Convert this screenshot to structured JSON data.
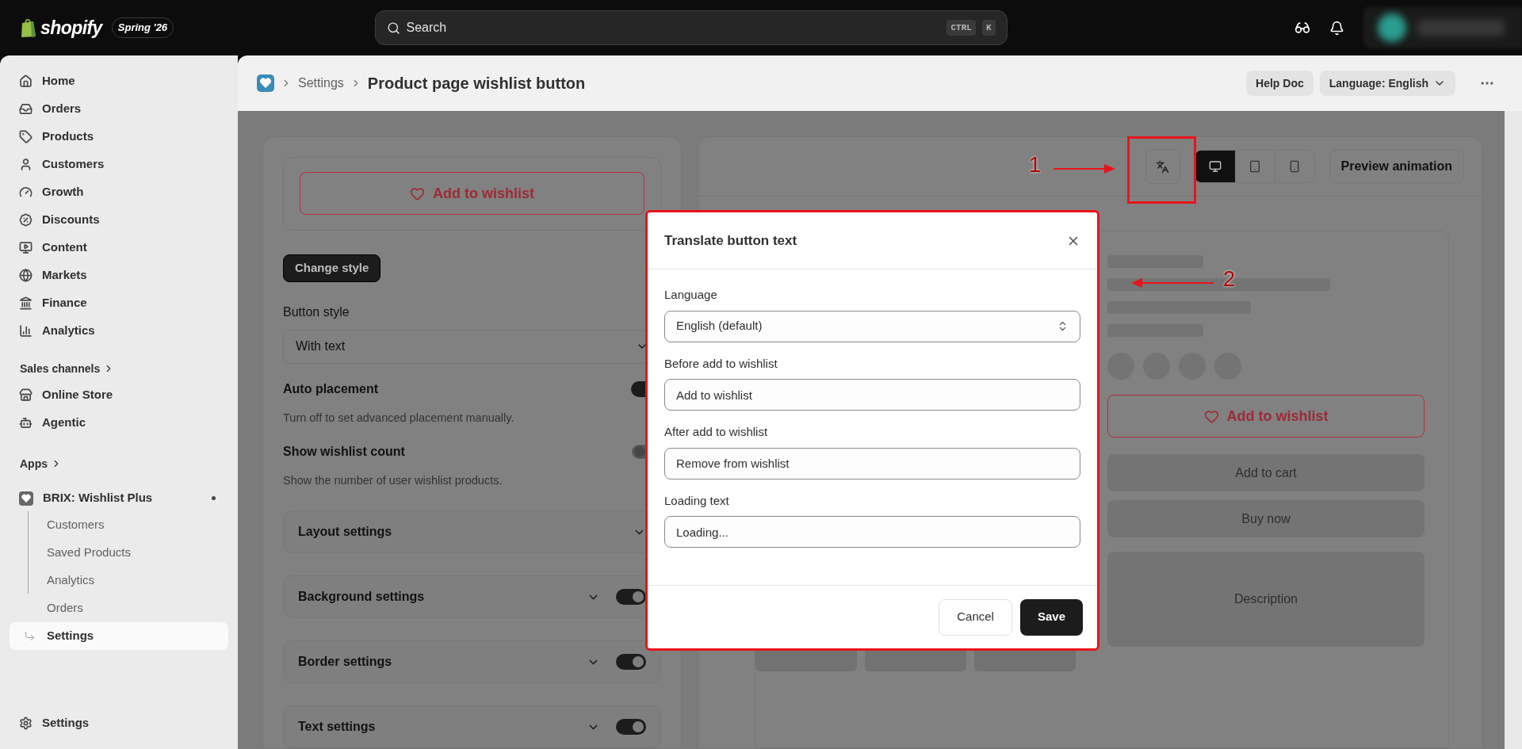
{
  "topbar": {
    "brand": "shopify",
    "badge": "Spring '26",
    "search": {
      "placeholder": "Search",
      "shortcut": [
        "CTRL",
        "K"
      ]
    }
  },
  "sidebar": {
    "items": [
      {
        "label": "Home",
        "selected": false
      },
      {
        "label": "Orders",
        "selected": false
      },
      {
        "label": "Products",
        "selected": false
      },
      {
        "label": "Customers",
        "selected": false
      },
      {
        "label": "Growth",
        "selected": false
      },
      {
        "label": "Discounts",
        "selected": false
      },
      {
        "label": "Content",
        "selected": false
      },
      {
        "label": "Markets",
        "selected": false
      },
      {
        "label": "Finance",
        "selected": false
      },
      {
        "label": "Analytics",
        "selected": false
      }
    ],
    "sales_channels": {
      "heading": "Sales channels",
      "items": [
        {
          "label": "Online Store",
          "selected": false
        },
        {
          "label": "Agentic",
          "selected": false
        }
      ]
    },
    "apps": {
      "heading": "Apps",
      "app": {
        "name": "BRIX: Wishlist Plus",
        "pinned": true,
        "children": [
          {
            "label": "Customers",
            "selected": false
          },
          {
            "label": "Saved Products",
            "selected": false
          },
          {
            "label": "Analytics",
            "selected": false
          },
          {
            "label": "Orders",
            "selected": false
          },
          {
            "label": "Settings",
            "selected": true
          }
        ]
      }
    },
    "footer_item": "Settings"
  },
  "header": {
    "breadcrumb": "Settings",
    "title": "Product page wishlist button",
    "buttons": [
      {
        "label": "Help Doc",
        "kind": "plain"
      },
      {
        "label": "Language: English",
        "kind": "dropdown"
      }
    ]
  },
  "left_panel": {
    "preview_button": "Add to wishlist",
    "change_style": "Change style",
    "button_style": {
      "label": "Button style",
      "value": "With text"
    },
    "toggles": [
      {
        "label": "Auto placement",
        "description": "Turn off to set advanced placement manually.",
        "on": true
      },
      {
        "label": "Show wishlist count",
        "description": "Show the number of user wishlist products.",
        "on": false
      }
    ],
    "sections": [
      {
        "title": "Layout settings",
        "kind": "plain"
      },
      {
        "title": "Background settings",
        "kind": "switch",
        "on": true
      },
      {
        "title": "Border settings",
        "kind": "switch",
        "on": true
      },
      {
        "title": "Text settings",
        "kind": "switch",
        "on": true
      }
    ]
  },
  "preview": {
    "devices": [
      {
        "selected": true
      },
      {
        "selected": false
      },
      {
        "selected": false
      }
    ],
    "animation_button": "Preview animation",
    "wishlist_button": "Add to wishlist",
    "buttons": [
      "Add to cart",
      "Buy now"
    ],
    "description": "Description"
  },
  "modal": {
    "title": "Translate button text",
    "fields": [
      {
        "label": "Language",
        "kind": "select",
        "value": "English (default)"
      },
      {
        "label": "Before add to wishlist",
        "kind": "text",
        "value": "Add to wishlist"
      },
      {
        "label": "After add to wishlist",
        "kind": "text",
        "value": "Remove from wishlist"
      },
      {
        "label": "Loading text",
        "kind": "text",
        "value": "Loading..."
      }
    ],
    "buttons": [
      {
        "label": "Cancel",
        "kind": "secondary"
      },
      {
        "label": "Save",
        "kind": "primary"
      }
    ]
  },
  "annotations": [
    {
      "label": "1"
    },
    {
      "label": "2"
    }
  ]
}
